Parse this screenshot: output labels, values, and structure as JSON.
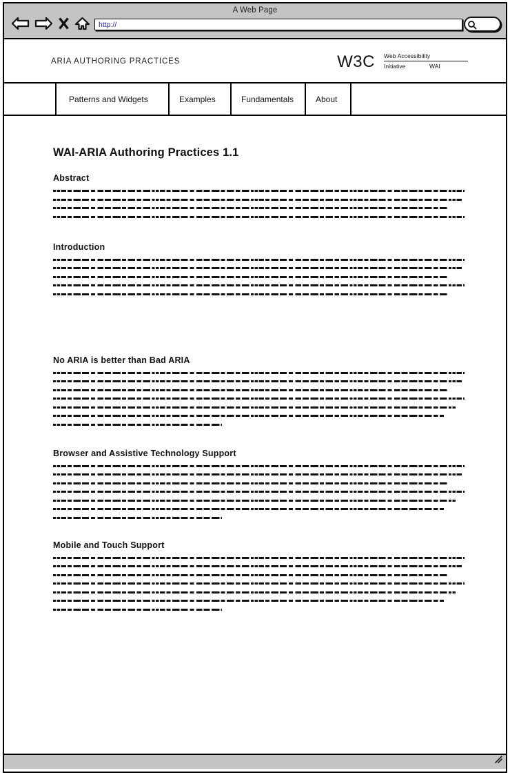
{
  "browser": {
    "window_title": "A Web Page",
    "url_value": "http://",
    "url_placeholder": "http://",
    "search_placeholder": "",
    "search_value": "",
    "controls": [
      {
        "name": "back-icon",
        "label": "Back"
      },
      {
        "name": "forward-icon",
        "label": "Forward"
      },
      {
        "name": "stop-icon",
        "label": "Stop"
      },
      {
        "name": "home-icon",
        "label": "Home"
      }
    ],
    "status_text": ""
  },
  "site_header": {
    "brand": "ARIA AUTHORING PRACTICES",
    "w3c_logo": "W3C",
    "wai_logo": {
      "top": "Web Accessibility",
      "initiative": "Initiative",
      "wai": "WAI"
    }
  },
  "nav": {
    "tabs": [
      {
        "label": "Patterns and Widgets"
      },
      {
        "label": "Examples"
      },
      {
        "label": "Fundamentals"
      },
      {
        "label": "About"
      }
    ]
  },
  "document": {
    "title": "WAI-ARIA Authoring Practices 1.1",
    "sections": [
      {
        "heading": "Abstract",
        "line_count": 4,
        "last_line_width_pct": 100
      },
      {
        "heading": "Introduction",
        "line_count": 5,
        "last_line_width_pct": 96
      },
      {
        "heading": "No ARIA is better than Bad ARIA",
        "line_count": 7,
        "last_line_width_pct": 41
      },
      {
        "heading": "Browser and Assistive Technology Support",
        "line_count": 7,
        "last_line_width_pct": 41
      },
      {
        "heading": "Mobile and Touch Support",
        "line_count": 7,
        "last_line_width_pct": 41
      }
    ]
  },
  "colors": {
    "chrome_gray": "#c4c4c4",
    "outline": "#000000",
    "url_text": "#1a1a8c",
    "page_background": "#ffffff"
  }
}
